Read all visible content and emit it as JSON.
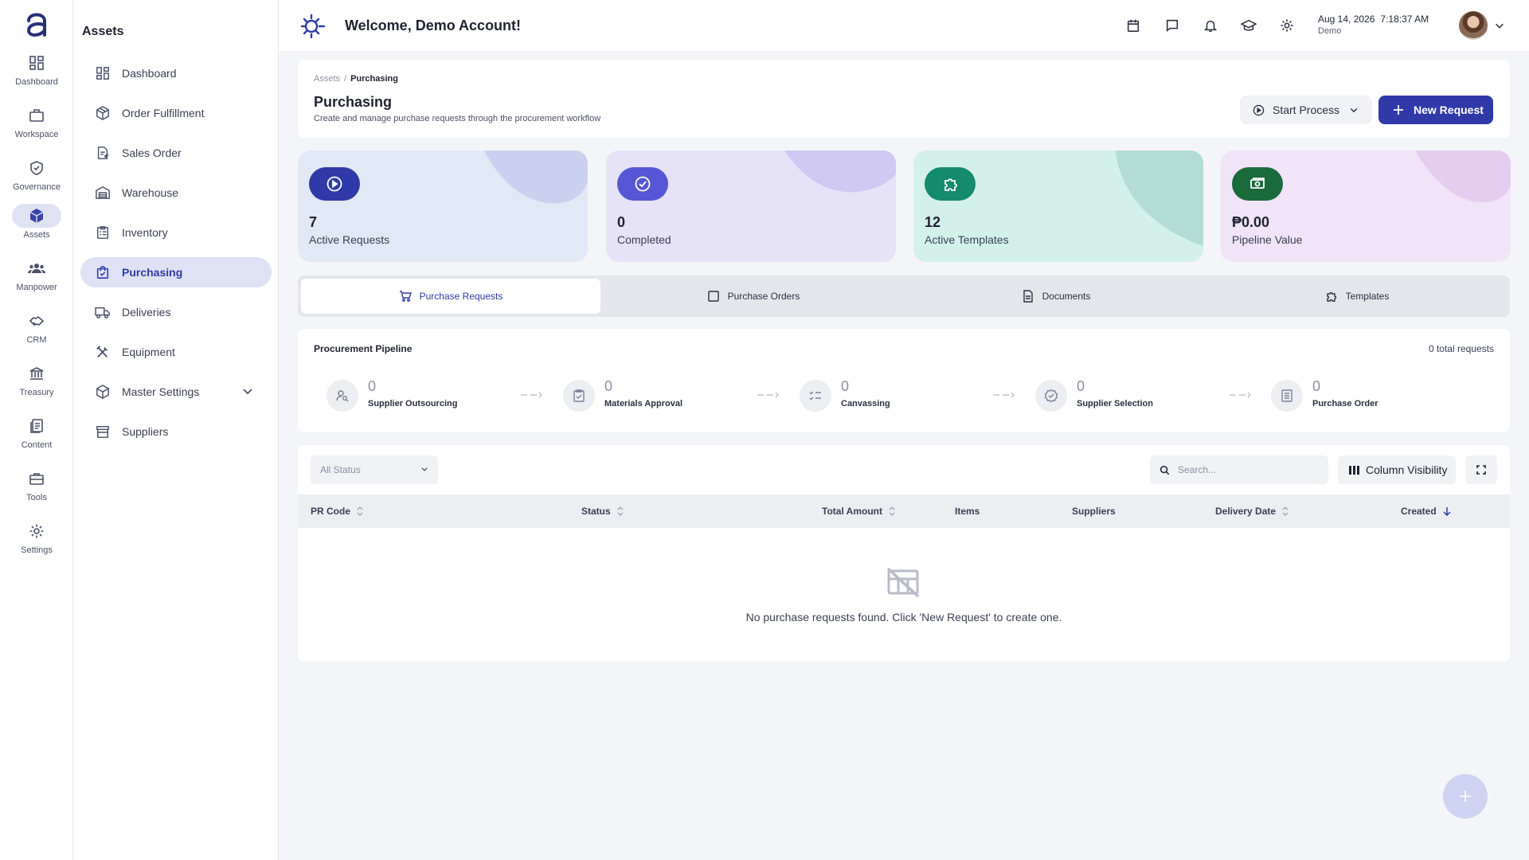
{
  "rail": {
    "items": [
      {
        "label": "Dashboard",
        "icon": "dashboard-icon"
      },
      {
        "label": "Workspace",
        "icon": "briefcase-icon"
      },
      {
        "label": "Governance",
        "icon": "shield-check-icon"
      },
      {
        "label": "Assets",
        "icon": "cube-icon"
      },
      {
        "label": "Manpower",
        "icon": "group-icon"
      },
      {
        "label": "CRM",
        "icon": "handshake-icon"
      },
      {
        "label": "Treasury",
        "icon": "bank-icon"
      },
      {
        "label": "Content",
        "icon": "documents-icon"
      },
      {
        "label": "Tools",
        "icon": "toolbox-icon"
      },
      {
        "label": "Settings",
        "icon": "gear-icon"
      }
    ]
  },
  "subnav": {
    "title": "Assets",
    "items": [
      {
        "label": "Dashboard"
      },
      {
        "label": "Order Fulfillment"
      },
      {
        "label": "Sales Order"
      },
      {
        "label": "Warehouse"
      },
      {
        "label": "Inventory"
      },
      {
        "label": "Purchasing"
      },
      {
        "label": "Deliveries"
      },
      {
        "label": "Equipment"
      },
      {
        "label": "Master Settings"
      },
      {
        "label": "Suppliers"
      }
    ]
  },
  "header": {
    "welcome": "Welcome, Demo Account!",
    "date": "Aug 14, 2026",
    "time": "7:18:37 AM",
    "user": "Demo"
  },
  "page": {
    "breadcrumb_parent": "Assets",
    "breadcrumb_sep": "/",
    "breadcrumb_current": "Purchasing",
    "title": "Purchasing",
    "subtitle": "Create and manage purchase requests through the procurement workflow",
    "start_process": "Start Process",
    "new_request": "New Request"
  },
  "stats": [
    {
      "value": "7",
      "label": "Active Requests",
      "bg": "#e1e8f6",
      "badge": "#2f3aa8",
      "blob": "#c9d1ee"
    },
    {
      "value": "0",
      "label": "Completed",
      "bg": "#e6e2f8",
      "badge": "#5557d6",
      "blob": "#cfc9f1"
    },
    {
      "value": "12",
      "label": "Active Templates",
      "bg": "#d3f0ea",
      "badge": "#148a6e",
      "blob": "#b4dcd6"
    },
    {
      "value": "₱0.00",
      "label": "Pipeline Value",
      "bg": "#f1e3f8",
      "badge": "#1b6a3b",
      "blob": "#e4cdf1"
    }
  ],
  "tabs": [
    {
      "label": "Purchase Requests"
    },
    {
      "label": "Purchase Orders"
    },
    {
      "label": "Documents"
    },
    {
      "label": "Templates"
    }
  ],
  "pipeline": {
    "title": "Procurement Pipeline",
    "total": "0 total requests",
    "stages": [
      {
        "count": "0",
        "label": "Supplier Outsourcing"
      },
      {
        "count": "0",
        "label": "Materials Approval"
      },
      {
        "count": "0",
        "label": "Canvassing"
      },
      {
        "count": "0",
        "label": "Supplier Selection"
      },
      {
        "count": "0",
        "label": "Purchase Order"
      }
    ]
  },
  "table": {
    "status_filter": "All Status",
    "search_placeholder": "Search...",
    "column_visibility": "Column Visibility",
    "columns": [
      {
        "label": "PR Code"
      },
      {
        "label": "Status"
      },
      {
        "label": "Total Amount"
      },
      {
        "label": "Items"
      },
      {
        "label": "Suppliers"
      },
      {
        "label": "Delivery Date"
      },
      {
        "label": "Created"
      }
    ],
    "empty_message": "No purchase requests found. Click 'New Request' to create one."
  },
  "colors": {
    "accent": "#2f3aa8",
    "background": "#f4f5f9"
  }
}
